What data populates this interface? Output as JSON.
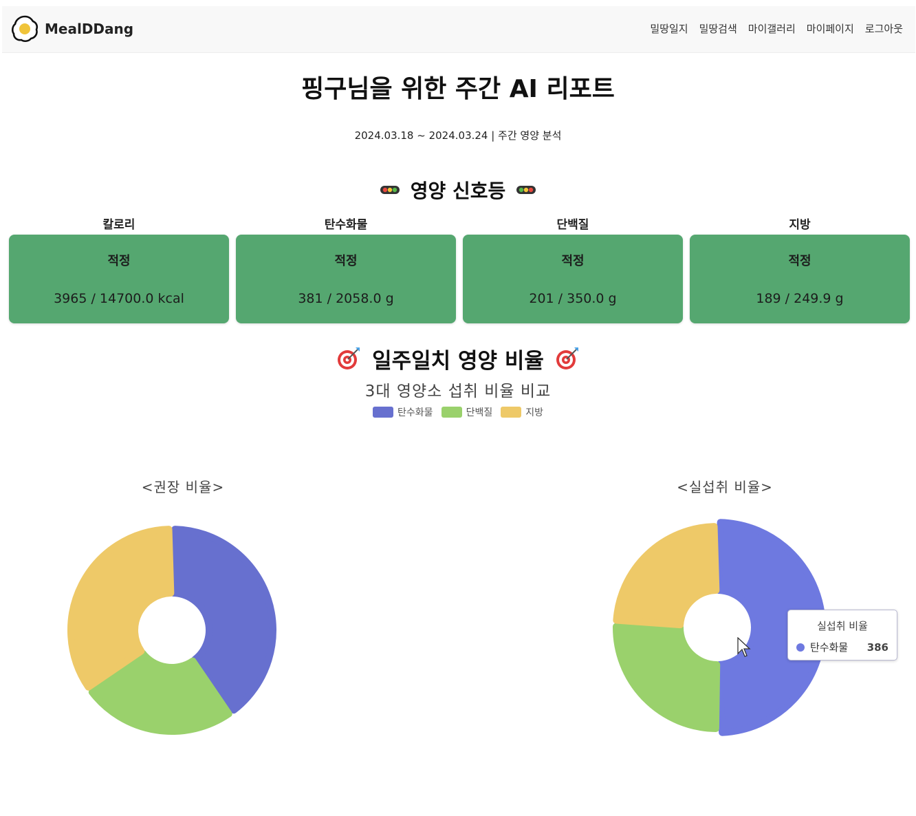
{
  "nav": {
    "brand": "MealDDang",
    "menu": [
      "밀땅일지",
      "밀땅검색",
      "마이갤러리",
      "마이페이지",
      "로그아웃"
    ]
  },
  "header": {
    "title": "핑구님을 위한 주간 AI 리포트",
    "period": "2024.03.18 ~ 2024.03.24 | 주간 영양 분석"
  },
  "signal": {
    "title": "영양 신호등",
    "cards": [
      {
        "label": "칼로리",
        "status": "적정",
        "value": "3965 / 14700.0 kcal"
      },
      {
        "label": "탄수화물",
        "status": "적정",
        "value": "381 / 2058.0 g"
      },
      {
        "label": "단백질",
        "status": "적정",
        "value": "201 / 350.0 g"
      },
      {
        "label": "지방",
        "status": "적정",
        "value": "189 / 249.9 g"
      }
    ]
  },
  "ratio": {
    "title": "일주일치 영양 비율",
    "subtitle": "3대 영양소 섭취 비율 비교",
    "legend": [
      {
        "name": "탄수화물",
        "color": "#6770cf"
      },
      {
        "name": "단백질",
        "color": "#9ad16c"
      },
      {
        "name": "지방",
        "color": "#eec968"
      }
    ]
  },
  "chart_data": [
    {
      "type": "pie",
      "title": "<권장 비율>",
      "categories": [
        "탄수화물",
        "단백질",
        "지방"
      ],
      "values": [
        40,
        25,
        35
      ],
      "colors": [
        "#6770cf",
        "#9ad16c",
        "#eec968"
      ]
    },
    {
      "type": "pie",
      "title": "<실섭취 비율>",
      "categories": [
        "탄수화물",
        "단백질",
        "지방"
      ],
      "values": [
        386,
        201,
        189
      ],
      "colors": [
        "#6e79e0",
        "#9ad16c",
        "#eec968"
      ]
    }
  ],
  "tooltip": {
    "title": "실섭취 비율",
    "label": "탄수화물",
    "value": "386",
    "color": "#6e79e0"
  }
}
